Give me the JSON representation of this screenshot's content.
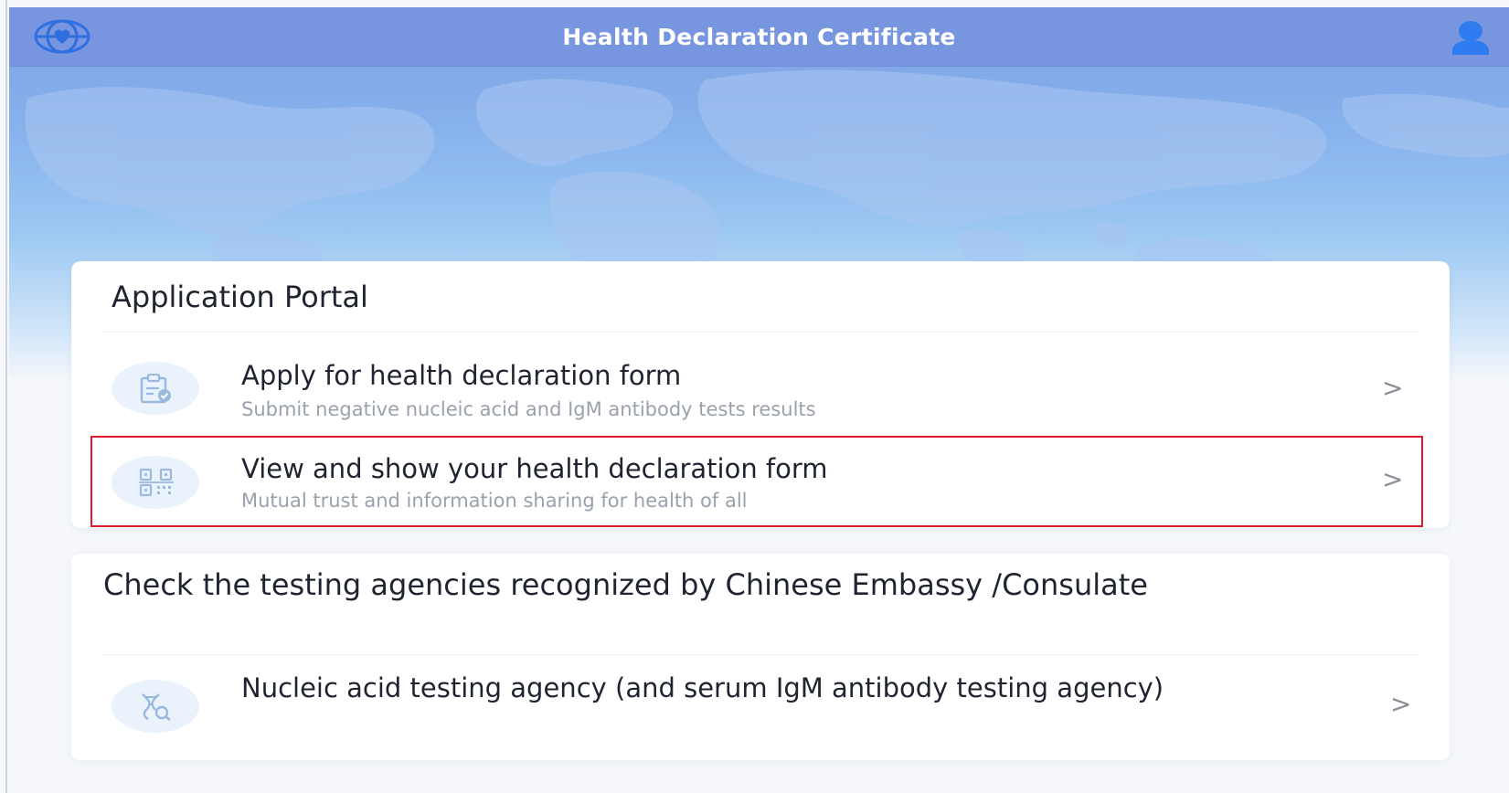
{
  "header": {
    "title": "Health Declaration Certificate",
    "logo_icon": "globe-heart-icon",
    "user_icon": "user-icon"
  },
  "portal": {
    "title": "Application Portal",
    "items": [
      {
        "title": "Apply for health declaration form",
        "subtitle": "Submit negative nucleic acid and IgM antibody tests results",
        "icon": "clipboard-check-icon",
        "chevron": ">"
      },
      {
        "title": "View and show your health declaration form",
        "subtitle": "Mutual trust and information sharing for health of all",
        "icon": "qr-code-icon",
        "chevron": ">"
      }
    ]
  },
  "agencies": {
    "title": "Check the testing agencies recognized by Chinese Embassy /Consulate",
    "items": [
      {
        "title": "Nucleic acid testing agency (and serum IgM antibody testing agency)",
        "icon": "dna-search-icon",
        "chevron": ">"
      }
    ]
  },
  "colors": {
    "header_bg": "#7896df",
    "accent": "#3d8ef0",
    "highlight": "#e21b2a"
  }
}
